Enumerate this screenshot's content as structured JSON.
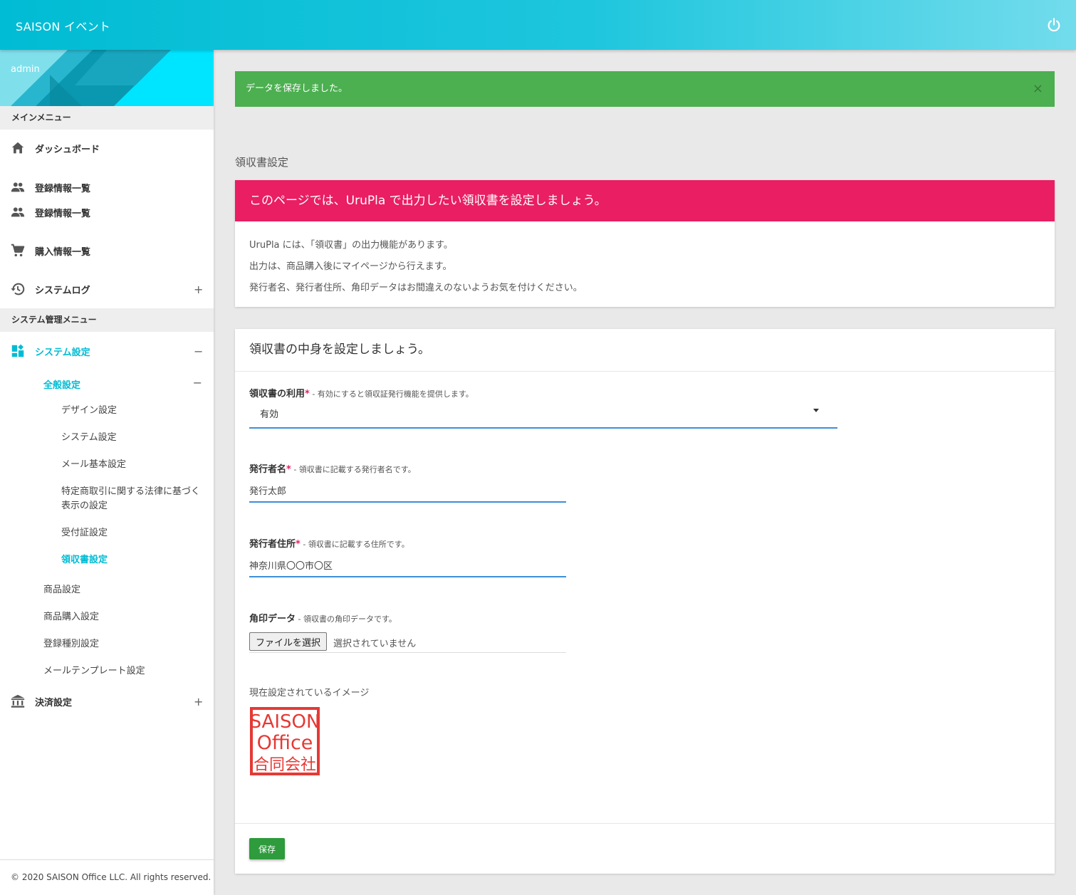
{
  "header": {
    "title": "SAISON イベント",
    "power_icon": "power-icon"
  },
  "sidebar": {
    "user": "admin",
    "main_menu_label": "メインメニュー",
    "main_items": [
      {
        "label": "ダッシュボード",
        "icon": "home-icon"
      },
      {
        "label": "登録情報一覧",
        "icon": "people-icon"
      },
      {
        "label": "登録情報一覧",
        "icon": "people-icon"
      },
      {
        "label": "購入情報一覧",
        "icon": "cart-icon"
      },
      {
        "label": "システムログ",
        "icon": "history-icon",
        "toggle": "+"
      }
    ],
    "admin_menu_label": "システム管理メニュー",
    "system_settings": {
      "label": "システム設定",
      "icon": "dashboard-icon",
      "toggle": "−"
    },
    "general_settings": {
      "label": "全般設定",
      "toggle": "−"
    },
    "general_sub": [
      "デザイン設定",
      "システム設定",
      "メール基本設定",
      "特定商取引に関する法律に基づく表示の設定",
      "受付証設定",
      "領収書設定"
    ],
    "other_sub": [
      "商品設定",
      "商品購入設定",
      "登録種別設定",
      "メールテンプレート設定"
    ],
    "payment": {
      "label": "決済設定",
      "icon": "bank-icon",
      "toggle": "+"
    },
    "footer": "© 2020 SAISON Office LLC. All rights reserved."
  },
  "alert": {
    "message": "データを保存しました。",
    "close": "×"
  },
  "page_title": "領収書設定",
  "intro": {
    "heading": "このページでは、UruPla で出力したい領収書を設定しましょう。",
    "lines": [
      "UruPla には、「領収書」の出力機能があります。",
      "出力は、商品購入後にマイページから行えます。",
      "発行者名、発行者住所、角印データはお間違えのないようお気を付けください。"
    ]
  },
  "form": {
    "heading": "領収書の中身を設定しましょう。",
    "use": {
      "label": "領収書の利用",
      "required": "*",
      "help": " - 有効にすると領収証発行機能を提供します。",
      "value": "有効"
    },
    "issuer_name": {
      "label": "発行者名",
      "required": "*",
      "help": " - 領収書に記載する発行者名です。",
      "value": "発行太郎"
    },
    "issuer_address": {
      "label": "発行者住所",
      "required": "*",
      "help": " - 領収書に記載する住所です。",
      "value": "神奈川県〇〇市〇区"
    },
    "stamp": {
      "label": "角印データ",
      "help": " - 領収書の角印データです。",
      "button": "ファイルを選択",
      "status": "選択されていません"
    },
    "current_image_label": "現在設定されているイメージ",
    "stamp_image": {
      "lines": [
        "SAISON",
        "Office",
        "合同会社"
      ],
      "color": "#e53935"
    },
    "save": "保存"
  },
  "colors": {
    "primary": "#00bcd4",
    "success": "#4caf50",
    "accent": "#e91e63",
    "save": "#2e9b3c",
    "input_line": "#3d8fd8"
  }
}
